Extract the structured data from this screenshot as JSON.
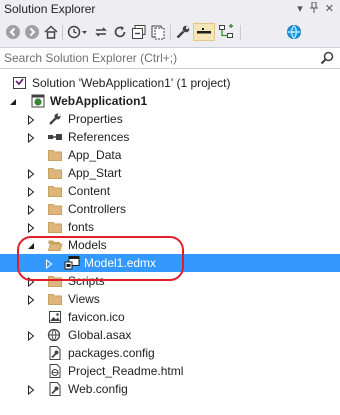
{
  "window": {
    "title": "Solution Explorer"
  },
  "search": {
    "placeholder": "Search Solution Explorer (Ctrl+;)"
  },
  "tree": {
    "solution": "Solution 'WebApplication1' (1 project)",
    "project": "WebApplication1",
    "items": [
      "Properties",
      "References",
      "App_Data",
      "App_Start",
      "Content",
      "Controllers",
      "fonts",
      "Models",
      "Model1.edmx",
      "Scripts",
      "Views",
      "favicon.ico",
      "Global.asax",
      "packages.config",
      "Project_Readme.html",
      "Web.config"
    ]
  },
  "colors": {
    "selection": "#3399ff",
    "annotation": "#e21d2b",
    "folder": "#dcb67a"
  }
}
